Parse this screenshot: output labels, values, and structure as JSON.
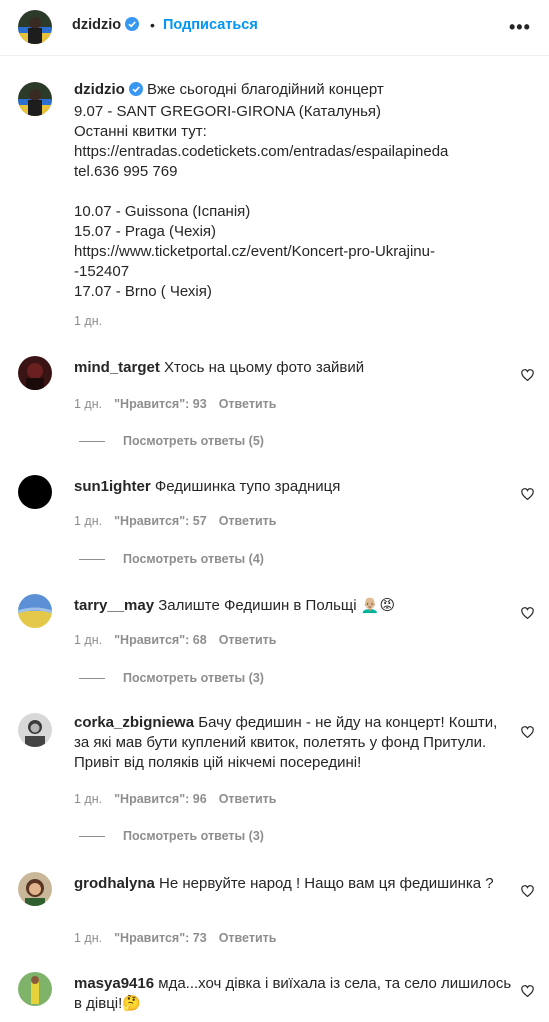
{
  "header": {
    "username": "dzidzio",
    "separator": "•",
    "follow_label": "Подписаться",
    "more_label": "•••"
  },
  "caption": {
    "username": "dzidzio",
    "lines": [
      "Вже сьогодні благодійний концерт",
      "9.07 - SANT GREGORI-GIRONA (Каталунья)",
      "Останні квитки тут:",
      "https://entradas.codetickets.com/entradas/espailapineda",
      "tel.636 995 769",
      "",
      "10.07 - Guissona (Іспанія)",
      "15.07 - Praga (Чехія)",
      "https://www.ticketportal.cz/event/Koncert-pro-Ukrajinu-",
      "-152407",
      "17.07 - Brno ( Чехія)"
    ],
    "time": "1 дн."
  },
  "comments": [
    {
      "username": "mind_target",
      "text": "Хтось на цьому фото зайвий",
      "time": "1 дн.",
      "likes": "\"Нравится\": 93",
      "reply": "Ответить",
      "replies": "Посмотреть ответы (5)"
    },
    {
      "username": "sun1ighter",
      "text": "Федишинка тупо зрадниця",
      "time": "1 дн.",
      "likes": "\"Нравится\": 57",
      "reply": "Ответить",
      "replies": "Посмотреть ответы (4)"
    },
    {
      "username": "tarry__may",
      "text": "Залиште Федишин в Польщі 👨🏼‍🦲😡",
      "time": "1 дн.",
      "likes": "\"Нравится\": 68",
      "reply": "Ответить",
      "replies": "Посмотреть ответы (3)"
    },
    {
      "username": "corka_zbigniewa",
      "text": "Бачу федишин - не йду на концерт! Кошти, за які мав бути куплений квиток, полетять у фонд Притули. Привіт від поляків цій нікчемі посередині!",
      "time": "1 дн.",
      "likes": "\"Нравится\": 96",
      "reply": "Ответить",
      "replies": "Посмотреть ответы (3)"
    },
    {
      "username": "grodhalyna",
      "text": "Не нервуйте народ ! Нащо вам ця федишинка ?",
      "time": "1 дн.",
      "likes": "\"Нравится\": 73",
      "reply": "Ответить"
    },
    {
      "username": "masya9416",
      "text": "мда...хоч дівка і виїхала із села, та село лишилось в дівці!🤔"
    }
  ],
  "icons": {
    "verified": "verified-badge-icon",
    "like": "heart-icon"
  },
  "colors": {
    "link": "#0095f6",
    "verified": "#3897f0",
    "secondary_text": "#8e8e8e"
  }
}
